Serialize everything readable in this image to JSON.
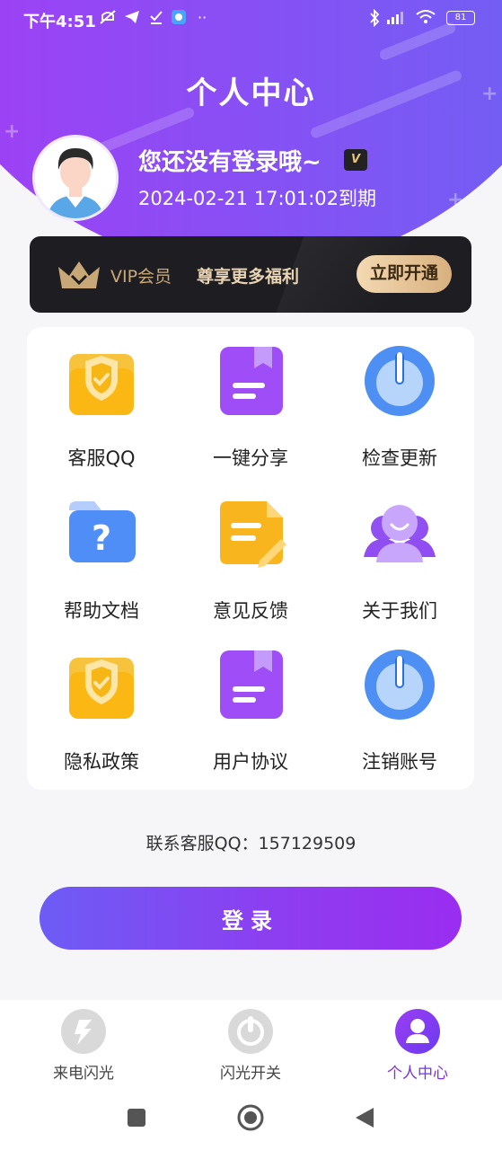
{
  "status_bar": {
    "time": "下午4:51",
    "battery": "81"
  },
  "header": {
    "title": "个人中心"
  },
  "profile": {
    "name": "您还没有登录哦~",
    "vip_badge": "V",
    "expire_text": "2024-02-21 17:01:02到期"
  },
  "vip_banner": {
    "label": "VIP会员",
    "desc": "尊享更多福利",
    "button": "立即开通"
  },
  "grid": [
    {
      "label": "客服QQ",
      "icon": "shield-folder-icon"
    },
    {
      "label": "一键分享",
      "icon": "bookmark-book-icon"
    },
    {
      "label": "检查更新",
      "icon": "power-icon"
    },
    {
      "label": "帮助文档",
      "icon": "help-folder-icon"
    },
    {
      "label": "意见反馈",
      "icon": "feedback-note-icon"
    },
    {
      "label": "关于我们",
      "icon": "users-icon"
    },
    {
      "label": "隐私政策",
      "icon": "shield-folder-icon"
    },
    {
      "label": "用户协议",
      "icon": "bookmark-book-icon"
    },
    {
      "label": "注销账号",
      "icon": "power-icon"
    }
  ],
  "contact_text": "联系客服QQ：157129509",
  "login_button": "登录",
  "tabs": [
    {
      "label": "来电闪光",
      "icon": "flash-icon",
      "active": false
    },
    {
      "label": "闪光开关",
      "icon": "power-toggle-icon",
      "active": false
    },
    {
      "label": "个人中心",
      "icon": "person-icon",
      "active": true
    }
  ],
  "colors": {
    "accent": "#8a3ef0",
    "vip_gold": "#d8b07e",
    "tab_active": "#7b2ff0"
  }
}
